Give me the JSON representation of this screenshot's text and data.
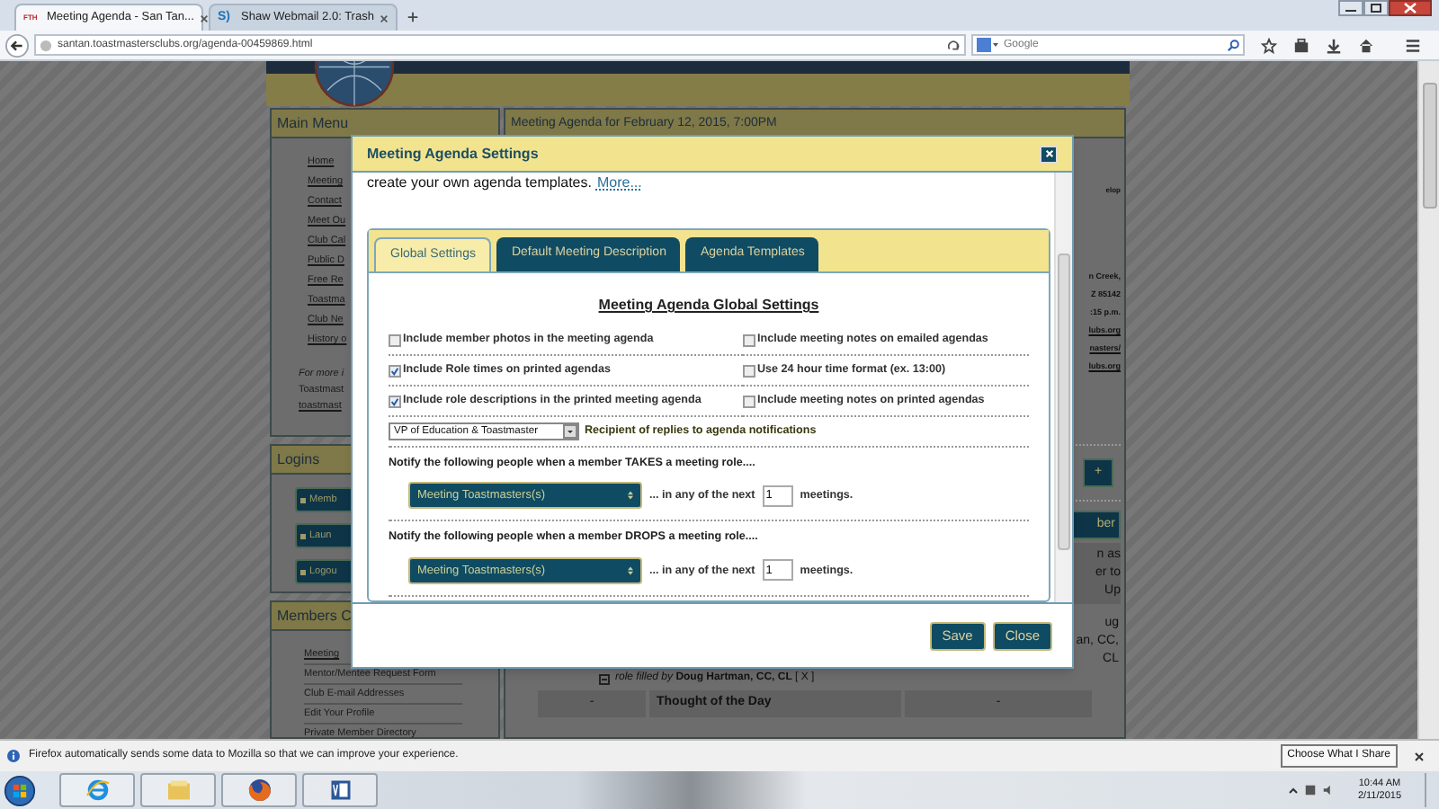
{
  "browser": {
    "tabs": [
      {
        "label": "Meeting Agenda - San Tan...",
        "selected": true,
        "favicon": "FTH"
      },
      {
        "label": "Shaw Webmail 2.0: Trash",
        "selected": false,
        "favicon": "S)"
      }
    ],
    "url": "santan.toastmastersclubs.org/agenda-00459869.html",
    "search": {
      "placeholder": "Google"
    }
  },
  "page": {
    "sidebar": {
      "main_menu": {
        "title": "Main Menu",
        "items": [
          "Home",
          "Meeting",
          "Contact",
          "Meet Ou",
          "Club Cal",
          "Public D",
          "Free Re",
          "Toastma",
          "Club Ne",
          "History o"
        ],
        "note": [
          "For more i",
          "Toastmast",
          "toastmast"
        ]
      },
      "logins": {
        "title": "Logins",
        "buttons": [
          "Memb",
          "Laun",
          "Logou"
        ]
      },
      "members": {
        "title": "Members C",
        "items": [
          "Meeting",
          "Mentor/Mentee Request Form",
          "Club E-mail Addresses",
          "Edit Your Profile",
          "Private Member Directory"
        ]
      }
    },
    "content": {
      "heading": "Meeting Agenda for February 12, 2015, 7:00PM",
      "side_text": "elop",
      "address": [
        "n Creek,",
        "Z 85142",
        ":15 p.m.",
        "lubs.org",
        "nasters/",
        "lubs.org"
      ],
      "add_button": "+",
      "member_button": "ber",
      "member_note": [
        "n as",
        "er to",
        "Up"
      ],
      "role_holder": [
        "ug",
        "an, CC,",
        "CL"
      ],
      "role_line": "*role filled by* **Doug Hartman, CC, CL** [ X ]",
      "agenda_row": {
        "time": "-",
        "item": "Thought of the Day",
        "duration": "-"
      }
    }
  },
  "dialog": {
    "title": "Meeting Agenda Settings",
    "intro": "create your own agenda templates.",
    "more_link": "More...",
    "tabs": [
      {
        "label": "Global Settings",
        "selected": true
      },
      {
        "label": "Default Meeting Description",
        "selected": false
      },
      {
        "label": "Agenda Templates",
        "selected": false
      }
    ],
    "heading": "Meeting Agenda Global Settings",
    "options": [
      {
        "label": "Include member photos in the meeting agenda",
        "checked": false
      },
      {
        "label": "Include meeting notes on emailed agendas",
        "checked": false
      },
      {
        "label": "Include Role times on printed agendas",
        "checked": true
      },
      {
        "label": "Use 24 hour time format (ex. 13:00)",
        "checked": false
      },
      {
        "label": "Include role descriptions in the printed meeting agenda",
        "checked": true
      },
      {
        "label": "Include meeting notes on printed agendas",
        "checked": false
      }
    ],
    "reply_recipient": {
      "value": "VP of Education & Toastmaster",
      "label": "Recipient of replies to agenda notifications"
    },
    "notifications": [
      {
        "label": "Notify the following people when a member TAKES a meeting role....",
        "select": "Meeting Toastmasters(s)",
        "prefix": "... in any of the next",
        "count": "1",
        "suffix": "meetings."
      },
      {
        "label": "Notify the following people when a member DROPS a meeting role....",
        "select": "Meeting Toastmasters(s)",
        "prefix": "... in any of the next",
        "count": "1",
        "suffix": "meetings."
      }
    ],
    "buttons": [
      "Save",
      "Close"
    ]
  },
  "notification_bar": {
    "message": "Firefox automatically sends some data to Mozilla so that we can improve your experience.",
    "button": "Choose What I Share"
  },
  "taskbar": {
    "time": "10:44 AM",
    "date": "2/11/2015"
  }
}
